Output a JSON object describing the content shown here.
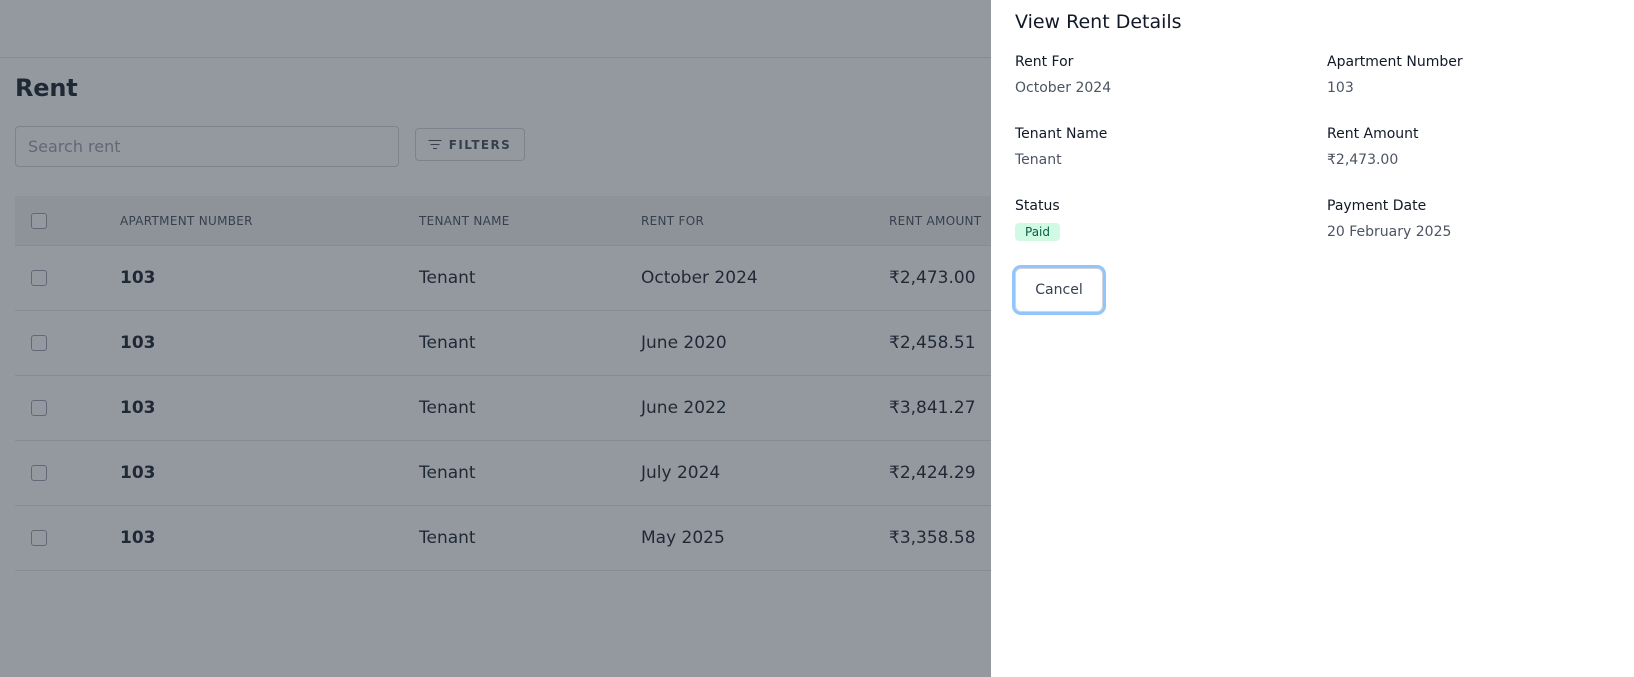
{
  "page": {
    "title": "Rent"
  },
  "search": {
    "placeholder": "Search rent"
  },
  "toolbar": {
    "filters_label": "FILTERS"
  },
  "table": {
    "headers": [
      "APARTMENT NUMBER",
      "TENANT NAME",
      "RENT FOR",
      "RENT AMOUNT"
    ],
    "rows": [
      {
        "apartment": "103",
        "tenant": "Tenant",
        "rent_for": "October 2024",
        "amount": "₹2,473.00"
      },
      {
        "apartment": "103",
        "tenant": "Tenant",
        "rent_for": "June 2020",
        "amount": "₹2,458.51"
      },
      {
        "apartment": "103",
        "tenant": "Tenant",
        "rent_for": "June 2022",
        "amount": "₹3,841.27"
      },
      {
        "apartment": "103",
        "tenant": "Tenant",
        "rent_for": "July 2024",
        "amount": "₹2,424.29"
      },
      {
        "apartment": "103",
        "tenant": "Tenant",
        "rent_for": "May 2025",
        "amount": "₹3,358.58"
      }
    ]
  },
  "drawer": {
    "title": "View Rent Details",
    "rent_for_label": "Rent For",
    "rent_for_value": "October 2024",
    "apartment_label": "Apartment Number",
    "apartment_value": "103",
    "tenant_label": "Tenant Name",
    "tenant_value": "Tenant",
    "amount_label": "Rent Amount",
    "amount_value": "₹2,473.00",
    "status_label": "Status",
    "status_value": "Paid",
    "payment_date_label": "Payment Date",
    "payment_date_value": "20 February 2025",
    "cancel_label": "Cancel"
  },
  "colors": {
    "status_paid_bg": "#d1fae5",
    "status_paid_text": "#065f46",
    "focus_ring": "#93c5fd"
  }
}
